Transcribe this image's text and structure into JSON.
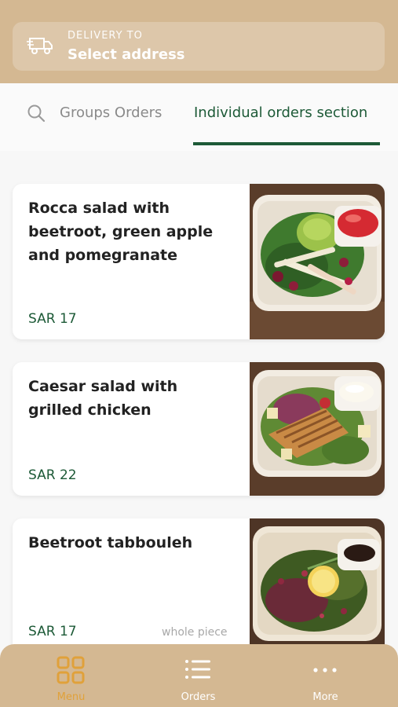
{
  "header": {
    "delivery_label": "DELIVERY TO",
    "address_value": "Select address"
  },
  "tabs": {
    "groups_label": "Groups Orders",
    "individual_label": "Individual orders section",
    "active": "individual"
  },
  "menu_items": [
    {
      "title": "Rocca salad with beetroot, green apple and pomegranate",
      "price": "SAR 17",
      "note": ""
    },
    {
      "title": "Caesar salad with grilled chicken",
      "price": "SAR 22",
      "note": ""
    },
    {
      "title": "Beetroot tabbouleh",
      "price": "SAR 17",
      "note": "whole piece"
    }
  ],
  "bottom_nav": {
    "items": [
      {
        "label": "Menu",
        "icon": "grid-icon",
        "active": true
      },
      {
        "label": "Orders",
        "icon": "list-icon",
        "active": false
      },
      {
        "label": "More",
        "icon": "more-icon",
        "active": false
      }
    ]
  },
  "colors": {
    "brand": "#d4b892",
    "accent_green": "#1d5a37",
    "active_nav": "#e0a13a"
  }
}
